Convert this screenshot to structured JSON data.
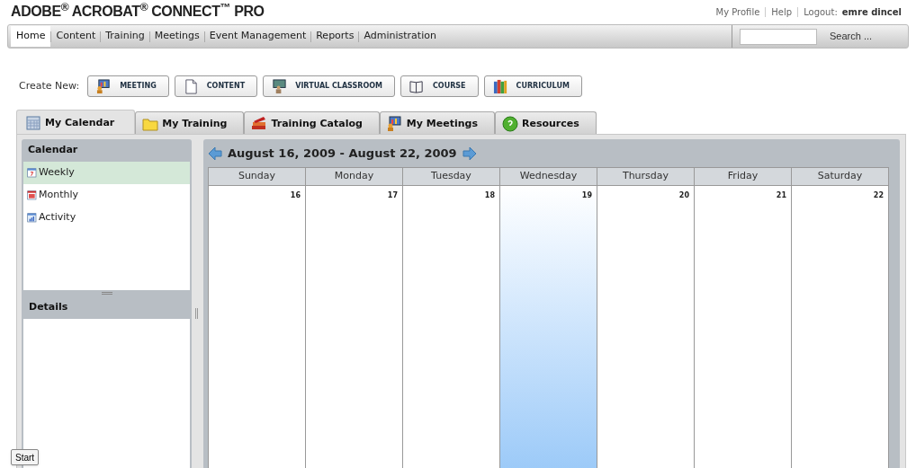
{
  "logo": "ADOBE$^{®}$ ACROBAT$^{®}$ CONNECT$^{™}$ PRO",
  "user_links": [
    {
      "label": "My Profile"
    },
    {
      "label": "Help"
    },
    {
      "label": "Logout:"
    }
  ],
  "user_name": "emre dincel",
  "nav": [
    {
      "label": "Home",
      "selected": true
    },
    {
      "label": "Content",
      "selected": false
    },
    {
      "label": "Training",
      "selected": false
    },
    {
      "label": "Meetings",
      "selected": false
    },
    {
      "label": "Event Management",
      "selected": false
    },
    {
      "label": "Reports",
      "selected": false
    },
    {
      "label": "Administration",
      "selected": false
    }
  ],
  "search": {
    "button": "Search ..."
  },
  "create_new": {
    "label": "Create New:",
    "buttons": [
      {
        "label": "MEETING",
        "kind": "meeting"
      },
      {
        "label": "CONTENT",
        "kind": "content"
      },
      {
        "label": "VIRTUAL CLASSROOM",
        "kind": "classroom"
      },
      {
        "label": "COURSE",
        "kind": "course"
      },
      {
        "label": "CURRICULUM",
        "kind": "curriculum"
      }
    ]
  },
  "tabs": [
    {
      "label": "My Calendar",
      "kind": "calendar",
      "selected": true
    },
    {
      "label": "My Training",
      "kind": "folder",
      "selected": false
    },
    {
      "label": "Training Catalog",
      "kind": "books",
      "selected": false
    },
    {
      "label": "My Meetings",
      "kind": "meeting",
      "selected": false
    },
    {
      "label": "Resources",
      "kind": "help",
      "selected": false
    }
  ],
  "sidebar": {
    "title": "Calendar",
    "items": [
      {
        "label": "Weekly",
        "kind": "week",
        "selected": true
      },
      {
        "label": "Monthly",
        "kind": "month",
        "selected": false
      },
      {
        "label": "Activity",
        "kind": "activity",
        "selected": false
      }
    ],
    "details_title": "Details"
  },
  "calendar": {
    "range": "August 16, 2009 - August 22, 2009",
    "days": [
      {
        "name": "Sunday",
        "date": "16",
        "selected": false
      },
      {
        "name": "Monday",
        "date": "17",
        "selected": false
      },
      {
        "name": "Tuesday",
        "date": "18",
        "selected": false
      },
      {
        "name": "Wednesday",
        "date": "19",
        "selected": true
      },
      {
        "name": "Thursday",
        "date": "20",
        "selected": false
      },
      {
        "name": "Friday",
        "date": "21",
        "selected": false
      },
      {
        "name": "Saturday",
        "date": "22",
        "selected": false
      }
    ]
  },
  "tooltip": "Start"
}
